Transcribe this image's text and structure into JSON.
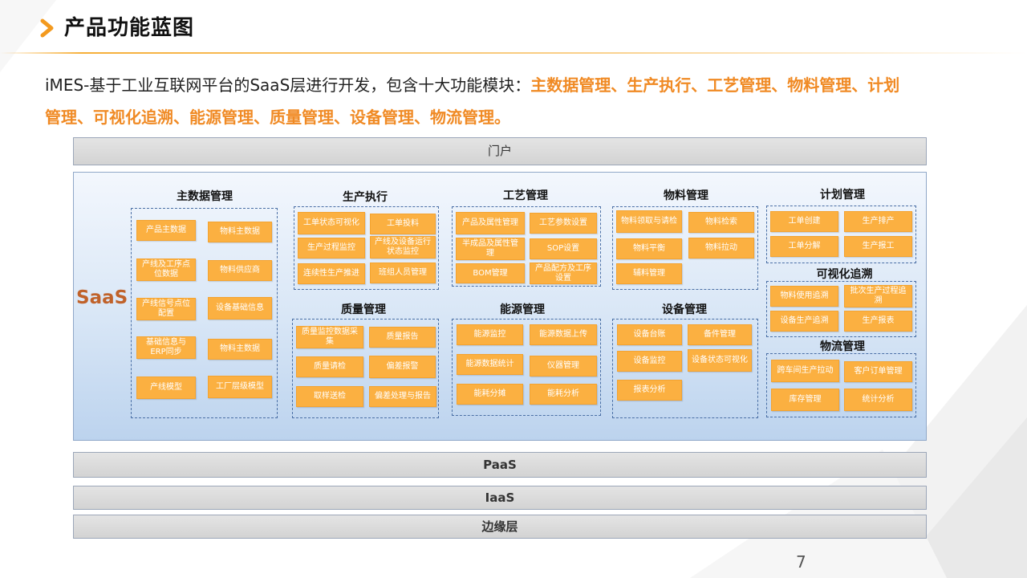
{
  "header": {
    "title": "产品功能蓝图"
  },
  "intro": {
    "prefix": "iMES-基于工业互联网平台的SaaS层进行开发，包含十大功能模块：",
    "highlight_line1": "主数据管理、生产执行、工艺管理、物料管理、计划",
    "highlight_line2": "管理、可视化追溯、能源管理、质量管理、设备管理、物流管理。"
  },
  "layers": {
    "portal": "门户",
    "saas": "SaaS",
    "paas": "PaaS",
    "iaas": "IaaS",
    "edge": "边缘层"
  },
  "groups": {
    "master_data": {
      "title": "主数据管理",
      "modules": [
        "产品主数据",
        "物料主数据",
        "产线及工序点位数据",
        "物料供应商",
        "产线信号点位配置",
        "设备基础信息",
        "基础信息与ERP同步",
        "物料主数据",
        "产线模型",
        "工厂层级模型"
      ]
    },
    "production": {
      "title": "生产执行",
      "modules": [
        "工单状态可视化",
        "工单投料",
        "生产过程监控",
        "产线及设备运行状态监控",
        "连续性生产推进",
        "班组人员管理"
      ]
    },
    "process": {
      "title": "工艺管理",
      "modules": [
        "产品及属性管理",
        "工艺参数设置",
        "半成品及属性管理",
        "SOP设置",
        "BOM管理",
        "产品配方及工序设置"
      ]
    },
    "material": {
      "title": "物料管理",
      "modules": [
        "物料领取与请检",
        "物料检索",
        "物料平衡",
        "物料拉动",
        "辅料管理"
      ]
    },
    "plan": {
      "title": "计划管理",
      "modules": [
        "工单创建",
        "生产排产",
        "工单分解",
        "生产报工"
      ]
    },
    "trace": {
      "title": "可视化追溯",
      "modules": [
        "物料使用追溯",
        "批次生产过程追溯",
        "设备生产追溯",
        "生产报表"
      ]
    },
    "quality": {
      "title": "质量管理",
      "modules": [
        "质量监控数据采集",
        "质量报告",
        "质量请检",
        "偏差报警",
        "取样送检",
        "偏差处理与报告"
      ]
    },
    "energy": {
      "title": "能源管理",
      "modules": [
        "能源监控",
        "能源数据上传",
        "能源数据统计",
        "仪器管理",
        "能耗分摊",
        "能耗分析"
      ]
    },
    "equipment": {
      "title": "设备管理",
      "modules": [
        "设备台账",
        "备件管理",
        "设备监控",
        "设备状态可视化",
        "报表分析"
      ]
    },
    "logistics": {
      "title": "物流管理",
      "modules": [
        "跨车间生产拉动",
        "客户订单管理",
        "库存管理",
        "统计分析"
      ]
    }
  },
  "page_number": "7",
  "colors": {
    "accent": "#f08a24",
    "module": "#fbb041",
    "saas_label": "#c0622a"
  }
}
